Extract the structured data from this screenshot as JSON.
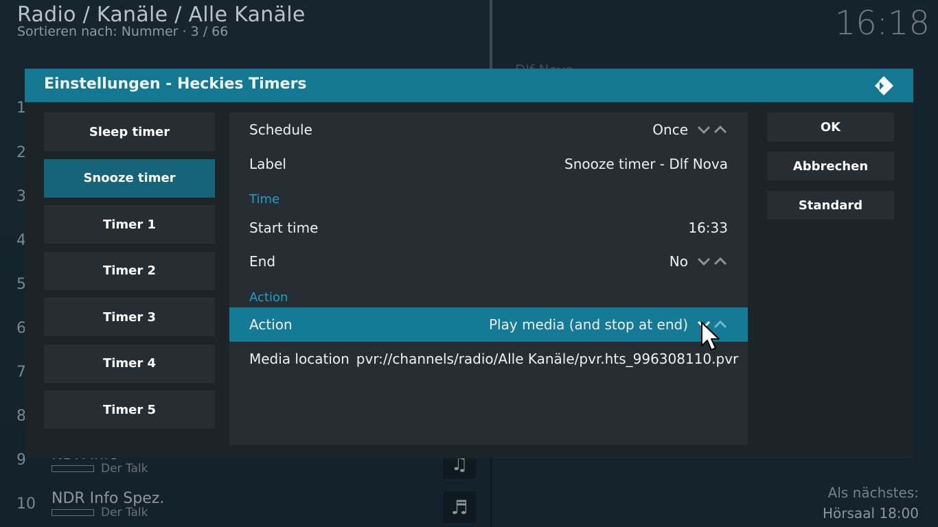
{
  "background": {
    "breadcrumb": "Radio / Kanäle / Alle Kanäle",
    "sort_info": "Sortieren nach: Nummer  ·  3 / 66",
    "clock": "16:18",
    "peek_text": "Dlf Nova",
    "row_numbers": [
      "1",
      "2",
      "3",
      "4",
      "5",
      "6",
      "7",
      "8"
    ],
    "channels": [
      {
        "number": "9",
        "name": "NDR Info",
        "program": "Der Talk",
        "icon": "music-note-icon"
      },
      {
        "number": "10",
        "name": "NDR Info Spez.",
        "program": "Der Talk",
        "icon": "music-note-icon"
      }
    ],
    "next_up_label": "Als nächstes:",
    "next_up_value": "Hörsaal 18:00"
  },
  "dialog": {
    "title": "Einstellungen - Heckies Timers",
    "categories": [
      {
        "label": "Sleep timer",
        "active": false
      },
      {
        "label": "Snooze timer",
        "active": true
      },
      {
        "label": "Timer 1",
        "active": false
      },
      {
        "label": "Timer 2",
        "active": false
      },
      {
        "label": "Timer 3",
        "active": false
      },
      {
        "label": "Timer 4",
        "active": false
      },
      {
        "label": "Timer 5",
        "active": false
      }
    ],
    "settings": {
      "schedule": {
        "label": "Schedule",
        "value": "Once"
      },
      "label": {
        "label": "Label",
        "value": "Snooze timer - Dlf Nova"
      },
      "group_time": "Time",
      "start_time": {
        "label": "Start time",
        "value": "16:33"
      },
      "end": {
        "label": "End",
        "value": "No"
      },
      "group_action": "Action",
      "action": {
        "label": "Action",
        "value": "Play media (and stop at end)"
      },
      "media_location": {
        "label": "Media location",
        "value": "pvr://channels/radio/Alle Kanäle/pvr.hts_996308110.pvr"
      }
    },
    "buttons": {
      "ok": "OK",
      "cancel": "Abbrechen",
      "default": "Standard"
    }
  },
  "colors": {
    "accent": "#147893",
    "focus": "#157a96",
    "group_label": "#1ea1c6",
    "panel": "#262e33"
  }
}
